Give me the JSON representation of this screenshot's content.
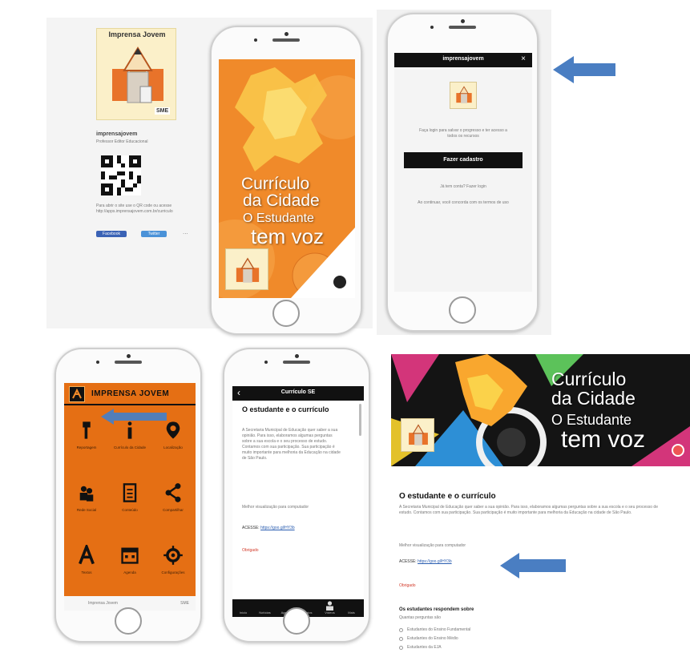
{
  "panel1": {
    "logo_text": "Imprensa Jovem",
    "logo_sub": "SME",
    "account_name": "imprensajovem",
    "account_sub": "Professor Editor Educacional",
    "scan_text": "Para abrir o site use o QR code ou acesse http://apps.imprensajovem.com.br/curriculo",
    "buttons": [
      "Facebook",
      "Twitter",
      "..."
    ]
  },
  "phone1": {
    "title_line1": "Currículo",
    "title_line2": "da Cidade",
    "title_line3": "O Estudante",
    "title_line4": "tem voz"
  },
  "phone2": {
    "header": "imprensajovem",
    "close": "×",
    "subtitle": "Faça login para salvar o progresso e ter acesso a todos os recursos",
    "primary_button": "Fazer cadastro",
    "login_prompt": "Já tem conta? Fazer login",
    "fine_print": "Ao continuar, você concorda com os termos de uso"
  },
  "phone3": {
    "app_title": "IMPRENSA JOVEM",
    "grid": [
      {
        "icon": "pin-icon",
        "label": "Reportagem"
      },
      {
        "icon": "info-icon",
        "label": "Currículo da Cidade"
      },
      {
        "icon": "map-marker-icon",
        "label": "Localização"
      },
      {
        "icon": "people-icon",
        "label": "Rede Social"
      },
      {
        "icon": "document-icon",
        "label": "Conteúdo"
      },
      {
        "icon": "share-icon",
        "label": "Compartilhar"
      },
      {
        "icon": "font-icon",
        "label": "Textos"
      },
      {
        "icon": "calendar-icon",
        "label": "Agenda"
      },
      {
        "icon": "settings-icon",
        "label": "Configurações"
      }
    ],
    "footer_left": "Imprensa Jovem",
    "footer_right": "SME"
  },
  "phone4": {
    "back": "‹",
    "header": "Currículo SE",
    "title": "O estudante e o currículo",
    "body": "A Secretaria Municipal de Educação quer saber a sua opinião. Para isso, elaboramos algumas perguntas sobre a sua escola e o seu processo de estudo. Contamos com sua participação. Sua participação é muito importante para melhoria da Educação na cidade de São Paulo.",
    "note": "Melhor visualização para computador",
    "link_label": "ACESSE:",
    "link": "https://goo.gl/HY3b",
    "red_text": "Obrigado",
    "tabs": [
      "Início",
      "Notícias",
      "Agenda",
      "Fotos",
      "Vídeos",
      "Mais"
    ]
  },
  "desktop": {
    "banner_line1": "Currículo",
    "banner_line2": "da Cidade",
    "banner_line3": "O Estudante",
    "banner_line4": "tem voz",
    "title": "O estudante e o currículo",
    "body": "A Secretaria Municipal de Educação quer saber a sua opinião. Para isso, elaboramos algumas perguntas sobre a sua escola e o seu processo de estudo. Contamos com sua participação. Sua participação é muito importante para melhoria da Educação na cidade de São Paulo.",
    "note": "Melhor visualização para computador",
    "link_label": "ACESSE:",
    "link": "https://goo.gl/HY3b",
    "red_text": "Obrigado",
    "section": "Os estudantes respondem sobre",
    "section_sub": "Quantas perguntas são",
    "list": [
      "Estudantes do Ensino Fundamental",
      "Estudantes do Ensino Médio",
      "Estudantes da EJA"
    ]
  },
  "colors": {
    "orange": "#f08a2a",
    "dark_orange": "#e56f14",
    "black": "#111111",
    "arrow_blue": "#4a7ec2",
    "link_blue": "#2a5db0",
    "red": "#d23a2a"
  }
}
